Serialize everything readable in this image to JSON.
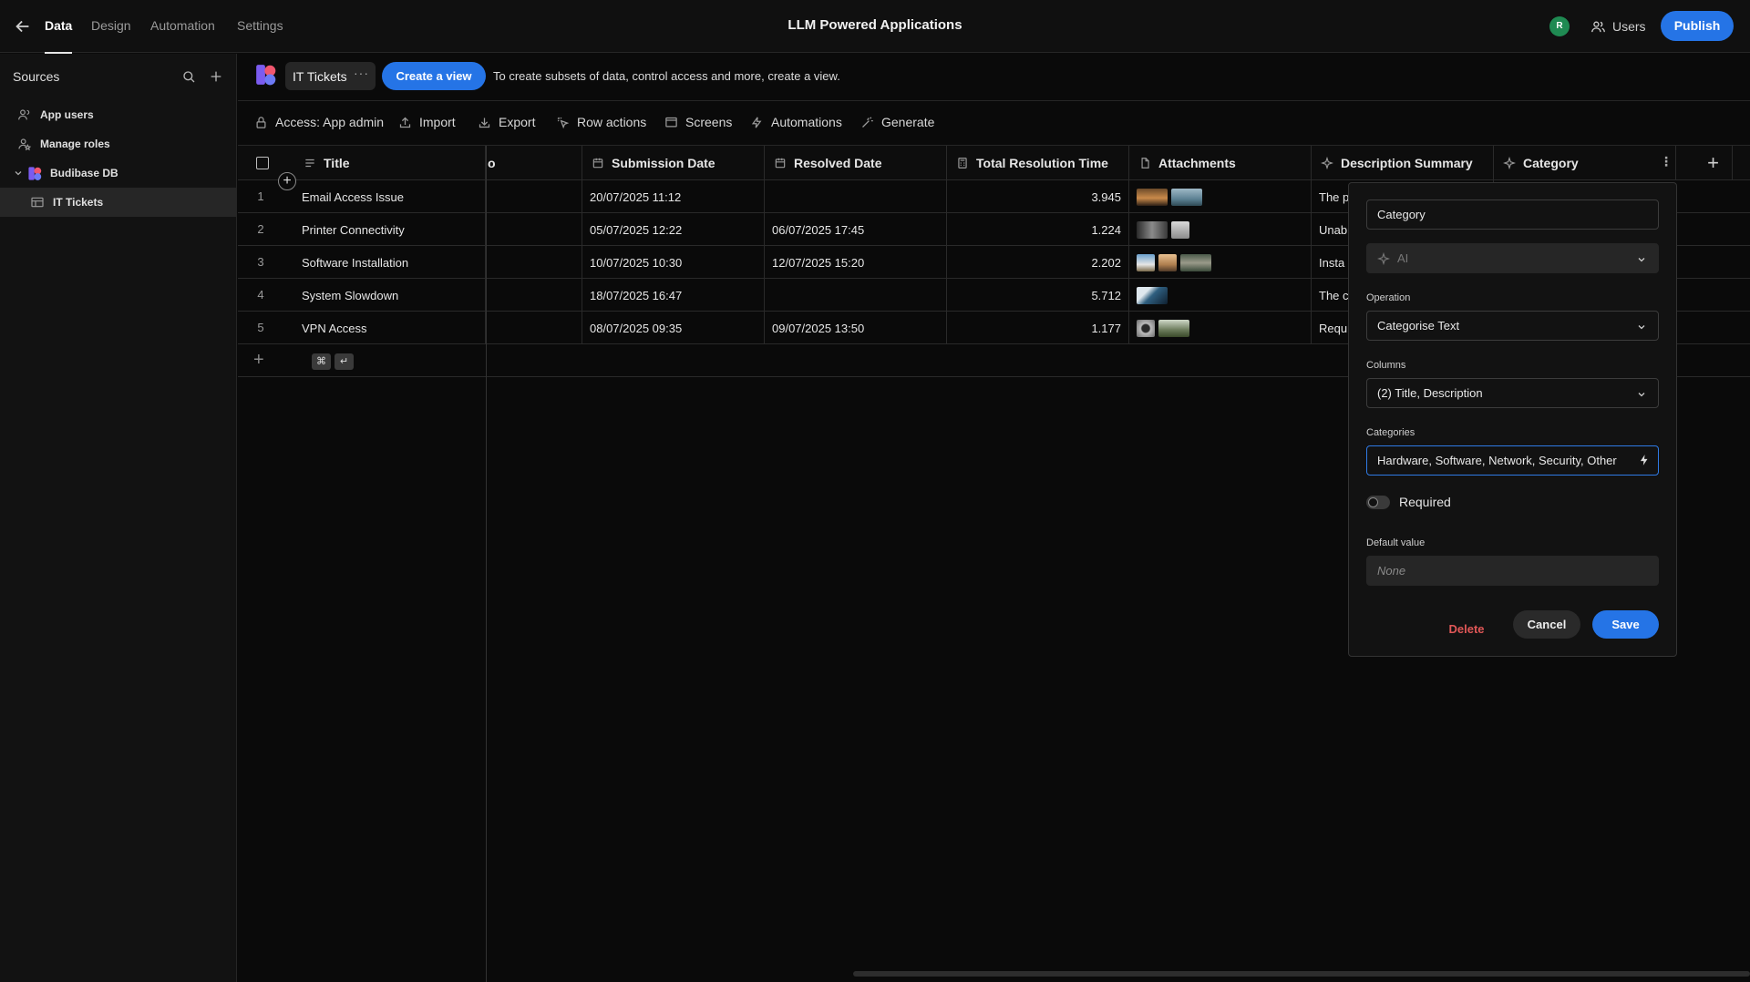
{
  "nav": {
    "tabs": [
      "Data",
      "Design",
      "Automation",
      "Settings"
    ],
    "active_tab": "Data",
    "app_title": "LLM Powered Applications",
    "avatar_initial": "R",
    "users_label": "Users",
    "publish_label": "Publish"
  },
  "sidebar": {
    "title": "Sources",
    "items": [
      {
        "label": "App users",
        "icon": "users-icon"
      },
      {
        "label": "Manage roles",
        "icon": "user-role-icon"
      },
      {
        "label": "Budibase DB",
        "icon": "budibase-logo"
      },
      {
        "label": "IT Tickets",
        "icon": "table-icon"
      }
    ]
  },
  "viewbar": {
    "table_name": "IT Tickets",
    "more_label": "···",
    "create_view_label": "Create a view",
    "hint": "To create subsets of data, control access and more, create a view."
  },
  "actions": [
    "Access: App admin",
    "Import",
    "Export",
    "Row actions",
    "Screens",
    "Automations",
    "Generate"
  ],
  "grid": {
    "columns": [
      "Title",
      "o",
      "Submission Date",
      "Resolved Date",
      "Total Resolution Time",
      "Attachments",
      "Description Summary",
      "Category"
    ],
    "rows": [
      {
        "num": "1",
        "title": "Email Access Issue",
        "submitted": "20/07/2025 11:12",
        "resolved": "",
        "time": "3.945",
        "summary": "The p"
      },
      {
        "num": "2",
        "title": "Printer Connectivity",
        "submitted": "05/07/2025 12:22",
        "resolved": "06/07/2025 17:45",
        "time": "1.224",
        "summary": "Unab"
      },
      {
        "num": "3",
        "title": "Software Installation",
        "submitted": "10/07/2025 10:30",
        "resolved": "12/07/2025 15:20",
        "time": "2.202",
        "summary": "Insta"
      },
      {
        "num": "4",
        "title": "System Slowdown",
        "submitted": "18/07/2025 16:47",
        "resolved": "",
        "time": "5.712",
        "summary": "The c"
      },
      {
        "num": "5",
        "title": "VPN Access",
        "submitted": "08/07/2025 09:35",
        "resolved": "09/07/2025 13:50",
        "time": "1.177",
        "summary": "Requ"
      }
    ],
    "shortcut_keys": [
      "⌘",
      "↵"
    ]
  },
  "popover": {
    "name_value": "Category",
    "type_value": "AI",
    "operation_label": "Operation",
    "operation_value": "Categorise Text",
    "columns_label": "Columns",
    "columns_value": "(2) Title, Description",
    "categories_label": "Categories",
    "categories_value": "Hardware, Software, Network, Security, Other",
    "required_label": "Required",
    "required_on": false,
    "default_label": "Default value",
    "default_placeholder": "None",
    "delete_label": "Delete",
    "cancel_label": "Cancel",
    "save_label": "Save"
  },
  "colors": {
    "accent": "#2574e6",
    "danger": "#e05757",
    "avatar": "#1f8a52"
  }
}
